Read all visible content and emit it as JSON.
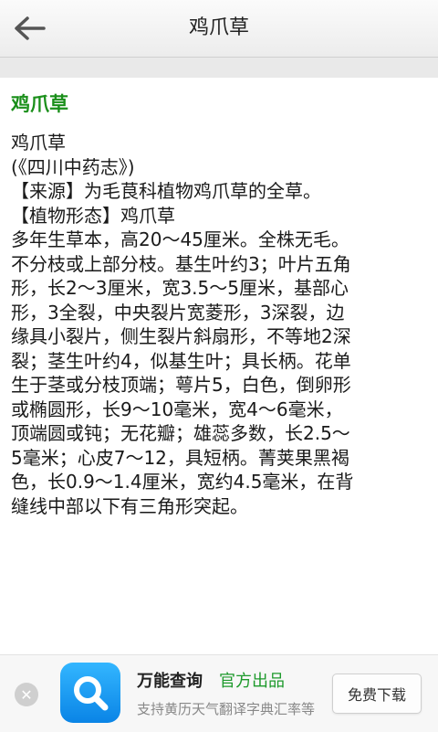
{
  "header": {
    "title": "鸡爪草",
    "back_icon": "arrow-left-icon"
  },
  "article": {
    "title": "鸡爪草",
    "lines": [
      "鸡爪草",
      "(《四川中药志》)",
      "【来源】为毛茛科植物鸡爪草的全草。",
      "【植物形态】鸡爪草",
      "多年生草本，高20～45厘米。全株无毛。",
      "不分枝或上部分枝。基生叶约3；叶片五角",
      "形，长2～3厘米，宽3.5～5厘米，基部心",
      "形，3全裂，中央裂片宽菱形，3深裂，边",
      "缘具小裂片，侧生裂片斜扇形，不等地2深",
      "裂；茎生叶约4，似基生叶；具长柄。花单",
      "生于茎或分枝顶端；萼片5，白色，倒卵形",
      "或椭圆形，长9～10毫米，宽4～6毫米，",
      "顶端圆或钝；无花瓣；雄蕊多数，长2.5～",
      "5毫米；心皮7～12，具短柄。菁荚果黑褐",
      "色，长0.9～1.4厘米，宽约4.5毫米，在背",
      "缝线中部以下有三角形突起。"
    ]
  },
  "ad": {
    "close_icon": "close-icon",
    "logo_icon": "search-magnifier-icon",
    "app_name": "万能查询",
    "tag": "官方出品",
    "description": "支持黄历天气翻译字典汇率等",
    "download_label": "免费下载",
    "colors": {
      "tag": "#1e9a2c",
      "logo": "#1a9bf2"
    }
  }
}
